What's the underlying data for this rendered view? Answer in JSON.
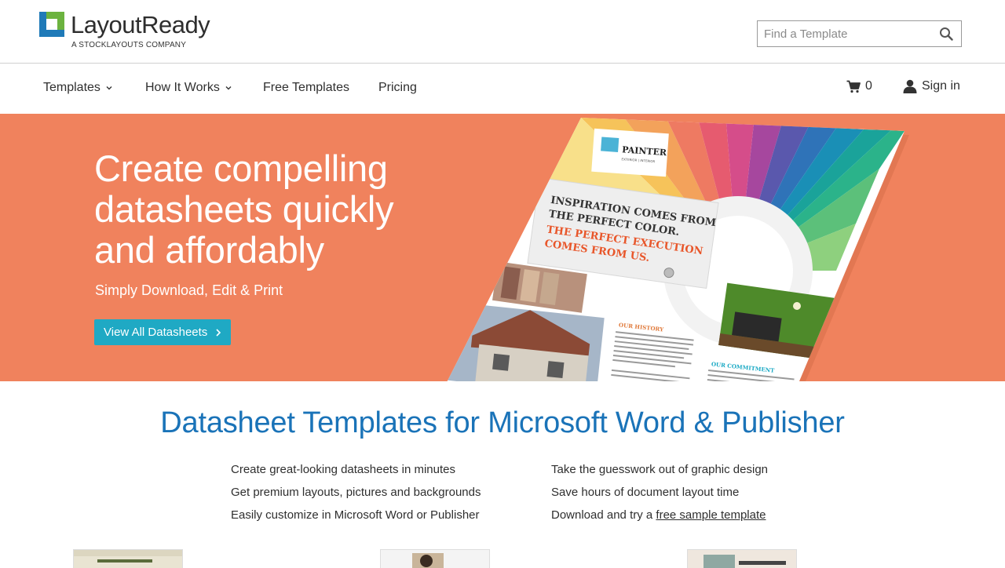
{
  "brand": {
    "name": "LayoutReady",
    "tagline": "A STOCKLAYOUTS COMPANY"
  },
  "search": {
    "placeholder": "Find a Template"
  },
  "nav": {
    "items": [
      {
        "label": "Templates"
      },
      {
        "label": "How It Works"
      },
      {
        "label": "Free Templates"
      },
      {
        "label": "Pricing"
      }
    ],
    "cart_count": "0",
    "signin_label": "Sign in"
  },
  "hero": {
    "title_lines": [
      "Create compelling",
      "datasheets quickly",
      "and affordably"
    ],
    "subtitle": "Simply Download, Edit & Print",
    "button_label": "View All Datasheets",
    "art": {
      "company": "PAINTER",
      "company_sub": "EXTERIOR | INTERIOR",
      "headline1": "INSPIRATION COMES FROM",
      "headline2": "THE PERFECT COLOR.",
      "headline3": "THE PERFECT EXECUTION",
      "headline4": "COMES FROM US.",
      "section1": "OUR HISTORY",
      "section2": "OUR COMMITMENT"
    }
  },
  "main": {
    "title": "Datasheet Templates for Microsoft Word & Publisher",
    "left_bullets": [
      "Create great-looking datasheets in minutes",
      "Get premium layouts, pictures and backgrounds",
      "Easily customize in Microsoft Word or Publisher"
    ],
    "right_bullets": [
      "Take the guesswork out of graphic design",
      "Save hours of document layout time"
    ],
    "download_prefix": "Download and try a ",
    "download_link": "free sample template"
  },
  "colors": {
    "hero_bg": "#f0825d",
    "accent_button": "#1fa9c4",
    "title_blue": "#1a73b8",
    "logo_blue": "#1f7ab8",
    "logo_green": "#6cb33f"
  }
}
